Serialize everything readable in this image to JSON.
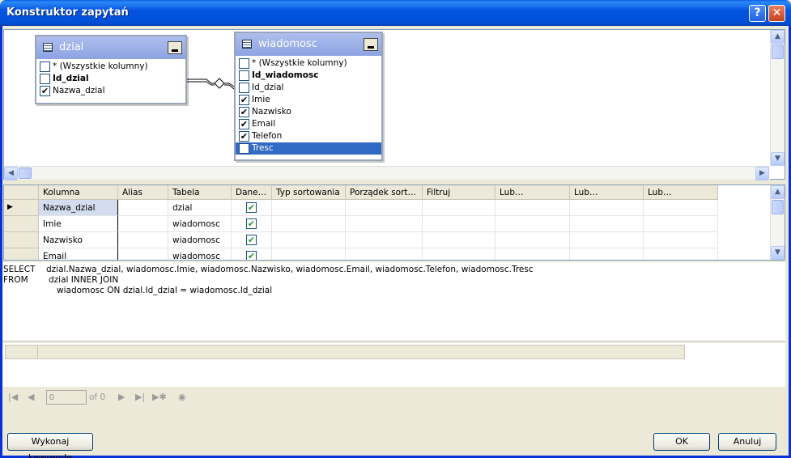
{
  "window": {
    "title": "Konstruktor zapytań",
    "help_label": "?",
    "close_label": "✕"
  },
  "diagram": {
    "tables": [
      {
        "name": "dzial",
        "columns": [
          {
            "label": "* (Wszystkie kolumny)",
            "checked": false,
            "bold": false
          },
          {
            "label": "Id_dzial",
            "checked": false,
            "bold": true
          },
          {
            "label": "Nazwa_dzial",
            "checked": true,
            "bold": false
          }
        ]
      },
      {
        "name": "wiadomosc",
        "columns": [
          {
            "label": "* (Wszystkie kolumny)",
            "checked": false,
            "bold": false
          },
          {
            "label": "Id_wiadomosc",
            "checked": false,
            "bold": true
          },
          {
            "label": "Id_dzial",
            "checked": false,
            "bold": false
          },
          {
            "label": "Imie",
            "checked": true,
            "bold": false
          },
          {
            "label": "Nazwisko",
            "checked": true,
            "bold": false
          },
          {
            "label": "Email",
            "checked": true,
            "bold": false
          },
          {
            "label": "Telefon",
            "checked": true,
            "bold": false
          },
          {
            "label": "Tresc",
            "checked": true,
            "bold": false,
            "selected": true
          }
        ]
      }
    ]
  },
  "grid": {
    "headers": [
      "Kolumna",
      "Alias",
      "Tabela",
      "Dane…",
      "Typ sortowania",
      "Porządek sort…",
      "Filtruj",
      "Lub…",
      "Lub…",
      "Lub…"
    ],
    "rows": [
      {
        "kolumna": "Nazwa_dzial",
        "alias": "",
        "tabela": "dzial",
        "dane": true
      },
      {
        "kolumna": "Imie",
        "alias": "",
        "tabela": "wiadomosc",
        "dane": true
      },
      {
        "kolumna": "Nazwisko",
        "alias": "",
        "tabela": "wiadomosc",
        "dane": true
      },
      {
        "kolumna": "Email",
        "alias": "",
        "tabela": "wiadomosc",
        "dane": true
      }
    ]
  },
  "sql": {
    "line1_kw": "SELECT",
    "line1": "dzial.Nazwa_dzial, wiadomosc.Imie, wiadomosc.Nazwisko, wiadomosc.Email, wiadomosc.Telefon, wiadomosc.Tresc",
    "line2_kw": "FROM",
    "line2": "dzial INNER JOIN",
    "line3": "wiadomosc ON dzial.Id_dzial = wiadomosc.Id_dzial"
  },
  "navigator": {
    "record_value": "0",
    "total_label": "of 0"
  },
  "buttons": {
    "execute": "Wykonaj kwerendę",
    "ok": "OK",
    "cancel": "Anuluj"
  }
}
